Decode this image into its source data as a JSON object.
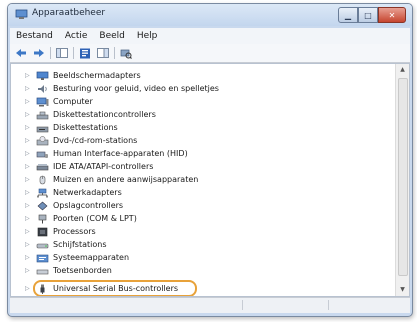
{
  "window": {
    "title": "Apparaatbeheer"
  },
  "menu": [
    "Bestand",
    "Actie",
    "Beeld",
    "Help"
  ],
  "tree": {
    "items": [
      {
        "label": "Beeldschermadapters",
        "icon": "display-adapter-icon"
      },
      {
        "label": "Besturing voor geluid, video en spelletjes",
        "icon": "sound-icon"
      },
      {
        "label": "Computer",
        "icon": "computer-icon"
      },
      {
        "label": "Diskettestationcontrollers",
        "icon": "floppy-controller-icon"
      },
      {
        "label": "Diskettestations",
        "icon": "floppy-drive-icon"
      },
      {
        "label": "Dvd-/cd-rom-stations",
        "icon": "dvd-drive-icon"
      },
      {
        "label": "Human Interface-apparaten (HID)",
        "icon": "hid-icon"
      },
      {
        "label": "IDE ATA/ATAPI-controllers",
        "icon": "ide-controller-icon"
      },
      {
        "label": "Muizen en andere aanwijsapparaten",
        "icon": "mouse-icon"
      },
      {
        "label": "Netwerkadapters",
        "icon": "network-adapter-icon"
      },
      {
        "label": "Opslagcontrollers",
        "icon": "storage-controller-icon"
      },
      {
        "label": "Poorten (COM & LPT)",
        "icon": "port-icon"
      },
      {
        "label": "Processors",
        "icon": "processor-icon"
      },
      {
        "label": "Schijfstations",
        "icon": "disk-drive-icon"
      },
      {
        "label": "Systeemapparaten",
        "icon": "system-device-icon"
      },
      {
        "label": "Toetsenborden",
        "icon": "keyboard-icon"
      },
      {
        "label": "Universal Serial Bus-controllers",
        "icon": "usb-icon",
        "highlighted": true
      }
    ]
  },
  "colors": {
    "highlight_ring": "#e8a23a",
    "window_frame": "#c9d9ee"
  }
}
